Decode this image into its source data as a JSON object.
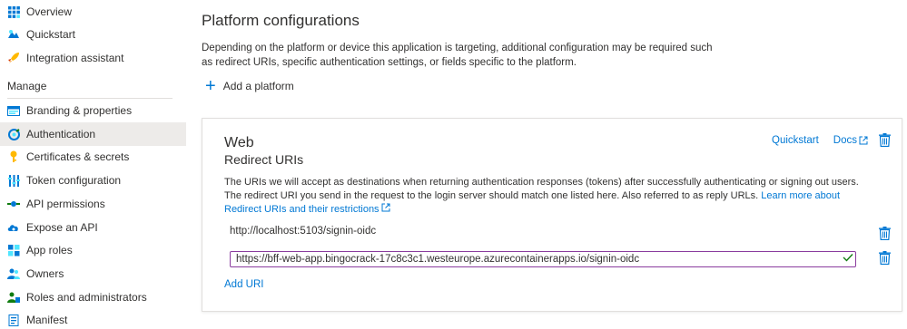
{
  "sidebar": {
    "items_top": [
      {
        "label": "Overview",
        "icon": "overview-icon"
      },
      {
        "label": "Quickstart",
        "icon": "quickstart-icon"
      },
      {
        "label": "Integration assistant",
        "icon": "rocket-icon"
      }
    ],
    "manage_header": "Manage",
    "items_manage": [
      {
        "label": "Branding & properties",
        "icon": "branding-icon"
      },
      {
        "label": "Authentication",
        "icon": "authentication-icon",
        "active": true
      },
      {
        "label": "Certificates & secrets",
        "icon": "key-icon"
      },
      {
        "label": "Token configuration",
        "icon": "token-icon"
      },
      {
        "label": "API permissions",
        "icon": "api-permissions-icon"
      },
      {
        "label": "Expose an API",
        "icon": "cloud-icon"
      },
      {
        "label": "App roles",
        "icon": "app-roles-icon"
      },
      {
        "label": "Owners",
        "icon": "owners-icon"
      },
      {
        "label": "Roles and administrators",
        "icon": "roles-icon"
      },
      {
        "label": "Manifest",
        "icon": "manifest-icon"
      }
    ]
  },
  "main": {
    "title": "Platform configurations",
    "description": "Depending on the platform or device this application is targeting, additional configuration may be required such as redirect URIs, specific authentication settings, or fields specific to the platform.",
    "add_platform_label": "Add a platform",
    "card": {
      "title": "Web",
      "subtitle": "Redirect URIs",
      "quickstart_link": "Quickstart",
      "docs_link": "Docs",
      "uri_description": "The URIs we will accept as destinations when returning authentication responses (tokens) after successfully authenticating or signing out users. The redirect URI you send in the request to the login server should match one listed here. Also referred to as reply URLs. ",
      "learn_more_link": "Learn more about Redirect URIs and their restrictions",
      "uris": [
        "http://localhost:5103/signin-oidc"
      ],
      "editing_uri": "https://bff-web-app.bingocrack-17c8c3c1.westeurope.azurecontainerapps.io/signin-oidc",
      "add_uri_label": "Add URI"
    }
  },
  "colors": {
    "accent": "#0078d4",
    "input_border": "#8a3c9e",
    "valid_check": "#107c10"
  }
}
